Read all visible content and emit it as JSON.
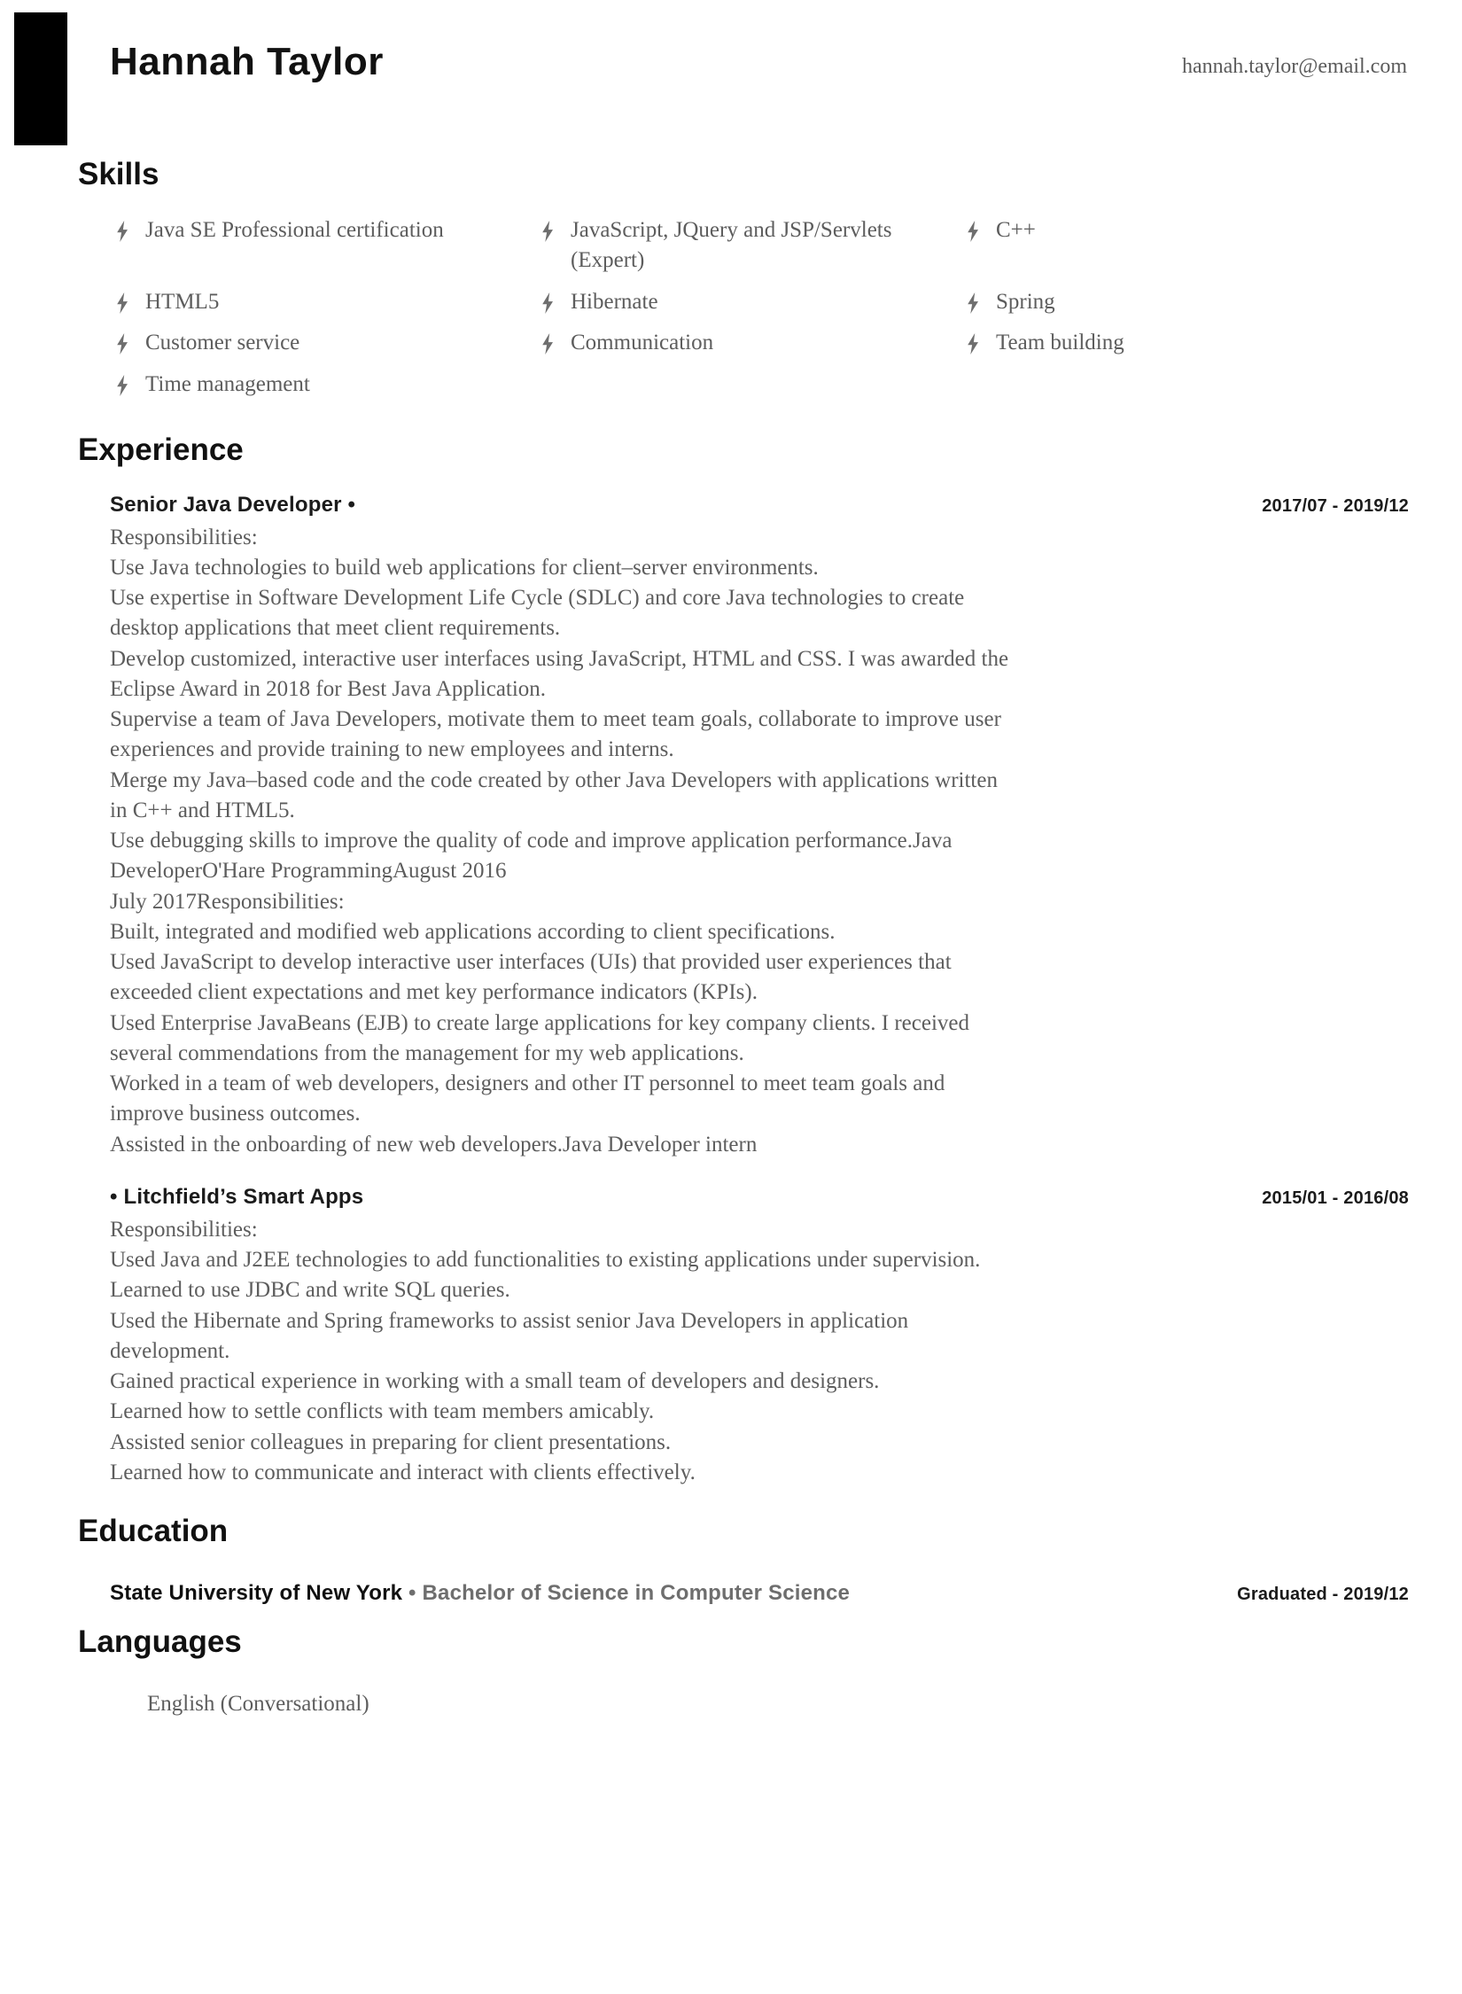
{
  "header": {
    "name": "Hannah Taylor",
    "email": "hannah.taylor@email.com"
  },
  "sections": {
    "skills_title": "Skills",
    "experience_title": "Experience",
    "education_title": "Education",
    "languages_title": "Languages"
  },
  "skills": {
    "bullet_icon": "lightning-bolt-icon",
    "items": [
      "Java SE Professional certification",
      "JavaScript, JQuery and JSP/Servlets (Expert)",
      "C++",
      "HTML5",
      "Hibernate",
      "Spring",
      "Customer service",
      "Communication",
      "Team building",
      "Time management"
    ]
  },
  "experience": {
    "entries": [
      {
        "title": "Senior Java Developer •",
        "date": "2017/07 - 2019/12",
        "lines": [
          "Responsibilities:",
          "Use Java technologies to build web applications for client–server environments.",
          "Use expertise in Software Development Life Cycle (SDLC) and core Java technologies to create desktop applications that meet client requirements.",
          "Develop customized, interactive user interfaces using JavaScript, HTML and CSS. I was awarded the Eclipse Award in 2018 for Best Java Application.",
          "Supervise a team of Java Developers, motivate them to meet team goals, collaborate to improve user experiences and provide training to new employees and interns.",
          "Merge my Java–based code and the code created by other Java Developers with applications written in C++ and HTML5.",
          "Use debugging skills to improve the quality of code and improve application performance.Java DeveloperO'Hare ProgrammingAugust 2016",
          "July 2017Responsibilities:",
          "Built, integrated and modified web applications according to client specifications.",
          "Used JavaScript to develop interactive user interfaces (UIs) that provided user experiences that exceeded client expectations and met key performance indicators (KPIs).",
          "Used Enterprise JavaBeans (EJB) to create large applications for key company clients. I received several commendations from the management for my web applications.",
          "Worked in a team of web developers, designers and other IT personnel to meet team goals and improve business outcomes.",
          "Assisted in the onboarding of new web developers.Java Developer intern"
        ]
      },
      {
        "title": "• Litchfield’s Smart Apps",
        "date": "2015/01 - 2016/08",
        "lines": [
          "Responsibilities:",
          "Used Java and J2EE technologies to add functionalities to existing applications under supervision.",
          "Learned to use JDBC and write SQL queries.",
          "Used the Hibernate and Spring frameworks to assist senior Java Developers in application development.",
          "Gained practical experience in working with a small team of developers and designers.",
          "Learned how to settle conflicts with team members amicably.",
          "Assisted senior colleagues in preparing for client presentations.",
          "Learned how to communicate and interact with clients effectively."
        ]
      }
    ]
  },
  "education": {
    "entries": [
      {
        "school": "State University of New York",
        "degree": "• Bachelor of Science in Computer Science",
        "date": "Graduated - 2019/12"
      }
    ]
  },
  "languages": {
    "items": [
      "English (Conversational)"
    ]
  },
  "colors": {
    "accent_bar": "#000000",
    "heading": "#111111",
    "body_text": "#5d5d5d",
    "date_text": "#1b1b1b",
    "degree_text": "#6e6e6e"
  }
}
